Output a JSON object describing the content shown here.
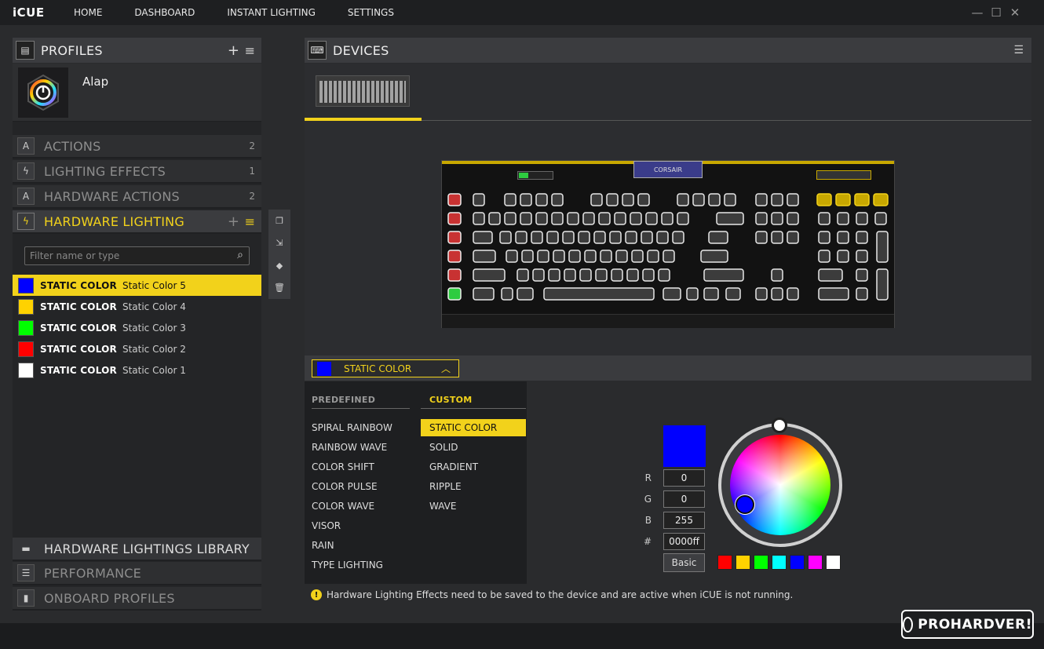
{
  "app": {
    "title": "iCUE"
  },
  "nav": [
    "HOME",
    "DASHBOARD",
    "INSTANT LIGHTING",
    "SETTINGS"
  ],
  "window_controls": {
    "minimize": "—",
    "maximize": "☐",
    "close": "✕"
  },
  "profiles": {
    "header": "PROFILES",
    "add": "+",
    "menu": "≡",
    "profile_name": "Alap"
  },
  "sections": [
    {
      "label": "ACTIONS",
      "count": "2"
    },
    {
      "label": "LIGHTING EFFECTS",
      "count": "1"
    },
    {
      "label": "HARDWARE ACTIONS",
      "count": "2"
    },
    {
      "label": "HARDWARE LIGHTING",
      "count": ""
    }
  ],
  "filter": {
    "placeholder": "Filter name or type"
  },
  "hardware_lightings": [
    {
      "type": "STATIC COLOR",
      "name": "Static Color 5",
      "color": "#0000ff",
      "selected": true
    },
    {
      "type": "STATIC COLOR",
      "name": "Static Color 4",
      "color": "#ffd200",
      "selected": false
    },
    {
      "type": "STATIC COLOR",
      "name": "Static Color 3",
      "color": "#00ff00",
      "selected": false
    },
    {
      "type": "STATIC COLOR",
      "name": "Static Color 2",
      "color": "#ff0000",
      "selected": false
    },
    {
      "type": "STATIC COLOR",
      "name": "Static Color 1",
      "color": "#ffffff",
      "selected": false
    }
  ],
  "bottom_sections": [
    {
      "label": "HARDWARE LIGHTINGS LIBRARY"
    },
    {
      "label": "PERFORMANCE"
    },
    {
      "label": "ONBOARD PROFILES"
    }
  ],
  "devices": {
    "header": "DEVICES",
    "keyboard_brand": "CORSAIR"
  },
  "effect": {
    "selected": "STATIC COLOR",
    "swatch": "#0000ff"
  },
  "predefined": {
    "header": "PREDEFINED",
    "items": [
      "SPIRAL RAINBOW",
      "RAINBOW WAVE",
      "COLOR SHIFT",
      "COLOR PULSE",
      "COLOR WAVE",
      "VISOR",
      "RAIN",
      "TYPE LIGHTING"
    ]
  },
  "custom": {
    "header": "CUSTOM",
    "items": [
      "STATIC COLOR",
      "SOLID",
      "GRADIENT",
      "RIPPLE",
      "WAVE"
    ],
    "selected": "STATIC COLOR"
  },
  "color": {
    "preview": "#0000ff",
    "r_label": "R",
    "r": "0",
    "g_label": "G",
    "g": "0",
    "b_label": "B",
    "b": "255",
    "hex_label": "#",
    "hex": "0000ff",
    "basic": "Basic",
    "palette": [
      "#ff0000",
      "#ffd200",
      "#00ff00",
      "#00ffff",
      "#0000ff",
      "#ff00ff",
      "#ffffff"
    ]
  },
  "info": "Hardware Lighting Effects need to be saved to the device and are active when iCUE is not running.",
  "watermark": "PROHARDVER!",
  "accent": "#f2d21b"
}
